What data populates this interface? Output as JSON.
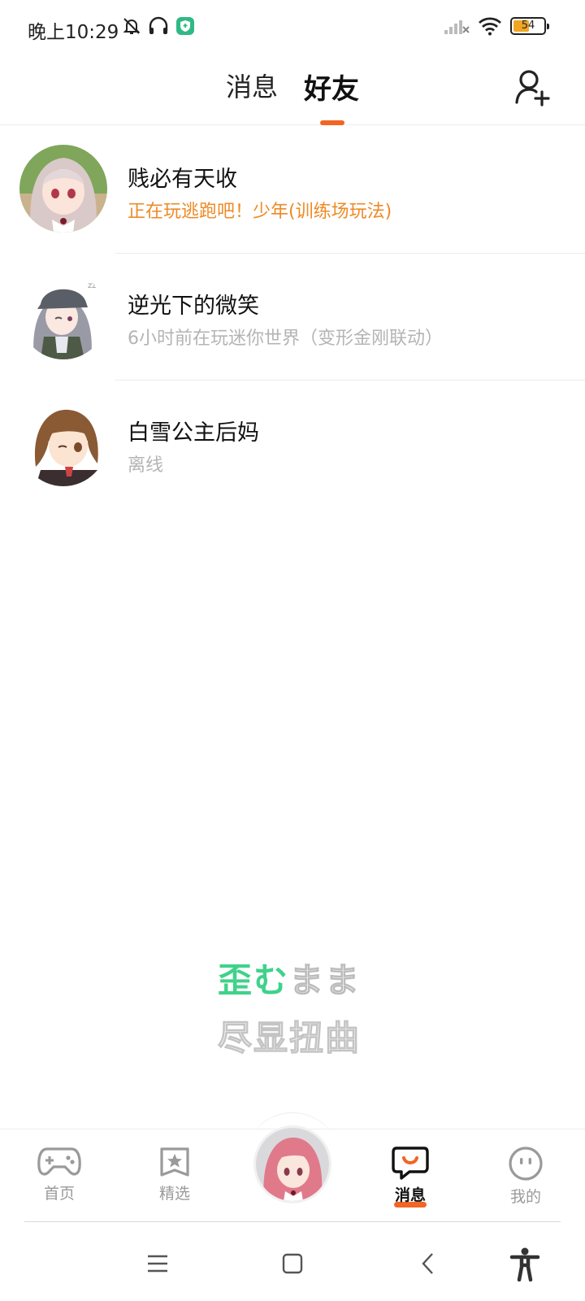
{
  "status_bar": {
    "time": "晚上10:29",
    "battery_level": "54",
    "battery_fraction": 0.54
  },
  "header": {
    "tabs": [
      {
        "label": "消息",
        "active": false
      },
      {
        "label": "好友",
        "active": true
      }
    ],
    "accent_color": "#f26522"
  },
  "friends": [
    {
      "name": "贱必有天收",
      "status": "正在玩逃跑吧！少年(训练场玩法)",
      "online": true
    },
    {
      "name": "逆光下的微笑",
      "status": "6小时前在玩迷你世界（变形金刚联动）",
      "online": false
    },
    {
      "name": "白雪公主后妈",
      "status": "离线",
      "online": false
    }
  ],
  "watermark": {
    "line1_colored": "歪む",
    "line1_outline": "まま",
    "line2": "尽显扭曲"
  },
  "bottom_nav": {
    "items": [
      {
        "label": "首页",
        "icon": "gamepad-icon"
      },
      {
        "label": "精选",
        "icon": "star-bookmark-icon"
      },
      {
        "label": "消息",
        "icon": "chat-bubble-icon",
        "active": true
      },
      {
        "label": "我的",
        "icon": "face-icon"
      }
    ]
  }
}
